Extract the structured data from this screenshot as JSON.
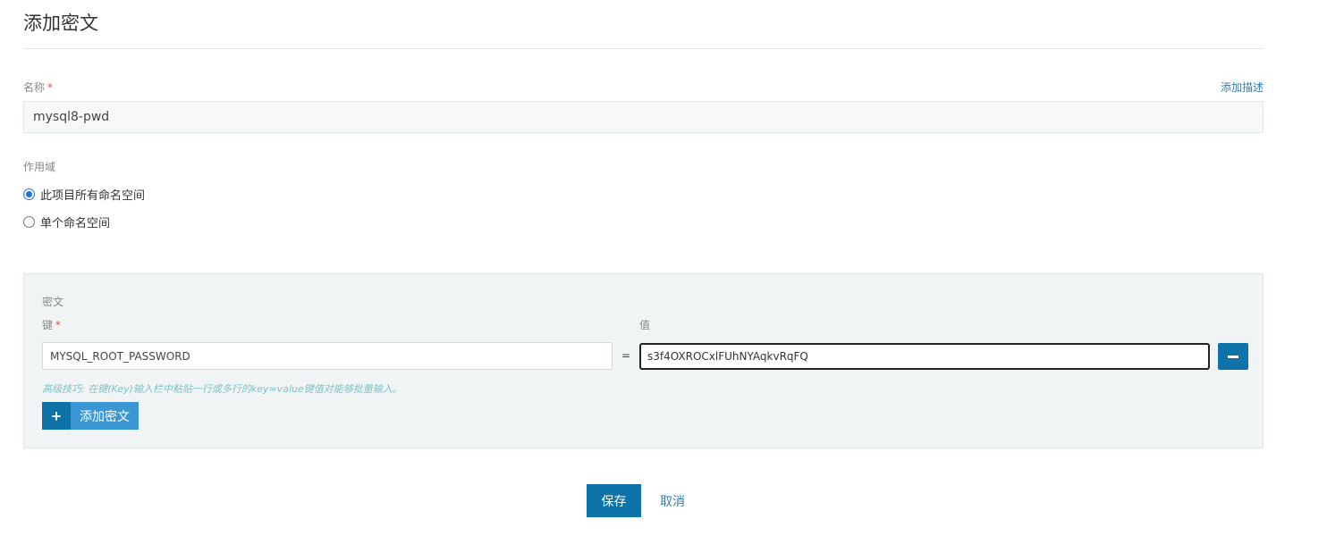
{
  "page": {
    "title": "添加密文"
  },
  "name_field": {
    "label": "名称",
    "required_mark": "*",
    "value": "mysql8-pwd",
    "add_description_link": "添加描述"
  },
  "scope": {
    "label": "作用域",
    "options": [
      {
        "label": "此项目所有命名空间",
        "checked": true
      },
      {
        "label": "单个命名空间",
        "checked": false
      }
    ]
  },
  "secrets": {
    "section_label": "密文",
    "key_label": "键",
    "key_required_mark": "*",
    "value_label": "值",
    "equals_sign": "=",
    "rows": [
      {
        "key": "MYSQL_ROOT_PASSWORD",
        "value": "s3f4OXROCxlFUhNYAqkvRqFQ"
      }
    ],
    "tip": "高级技巧: 在键(Key)输入栏中粘贴一行或多行的key=value键值对能够批量输入。",
    "add_button_icon": "+",
    "add_button_label": "添加密文"
  },
  "actions": {
    "save_label": "保存",
    "cancel_label": "取消"
  },
  "colors": {
    "primary": "#0e73a8",
    "primary_light": "#3b97d3",
    "link": "#2f7db8",
    "required": "#d9534f",
    "tip": "#7dc3c9",
    "panel_bg": "#f0f4f4"
  }
}
